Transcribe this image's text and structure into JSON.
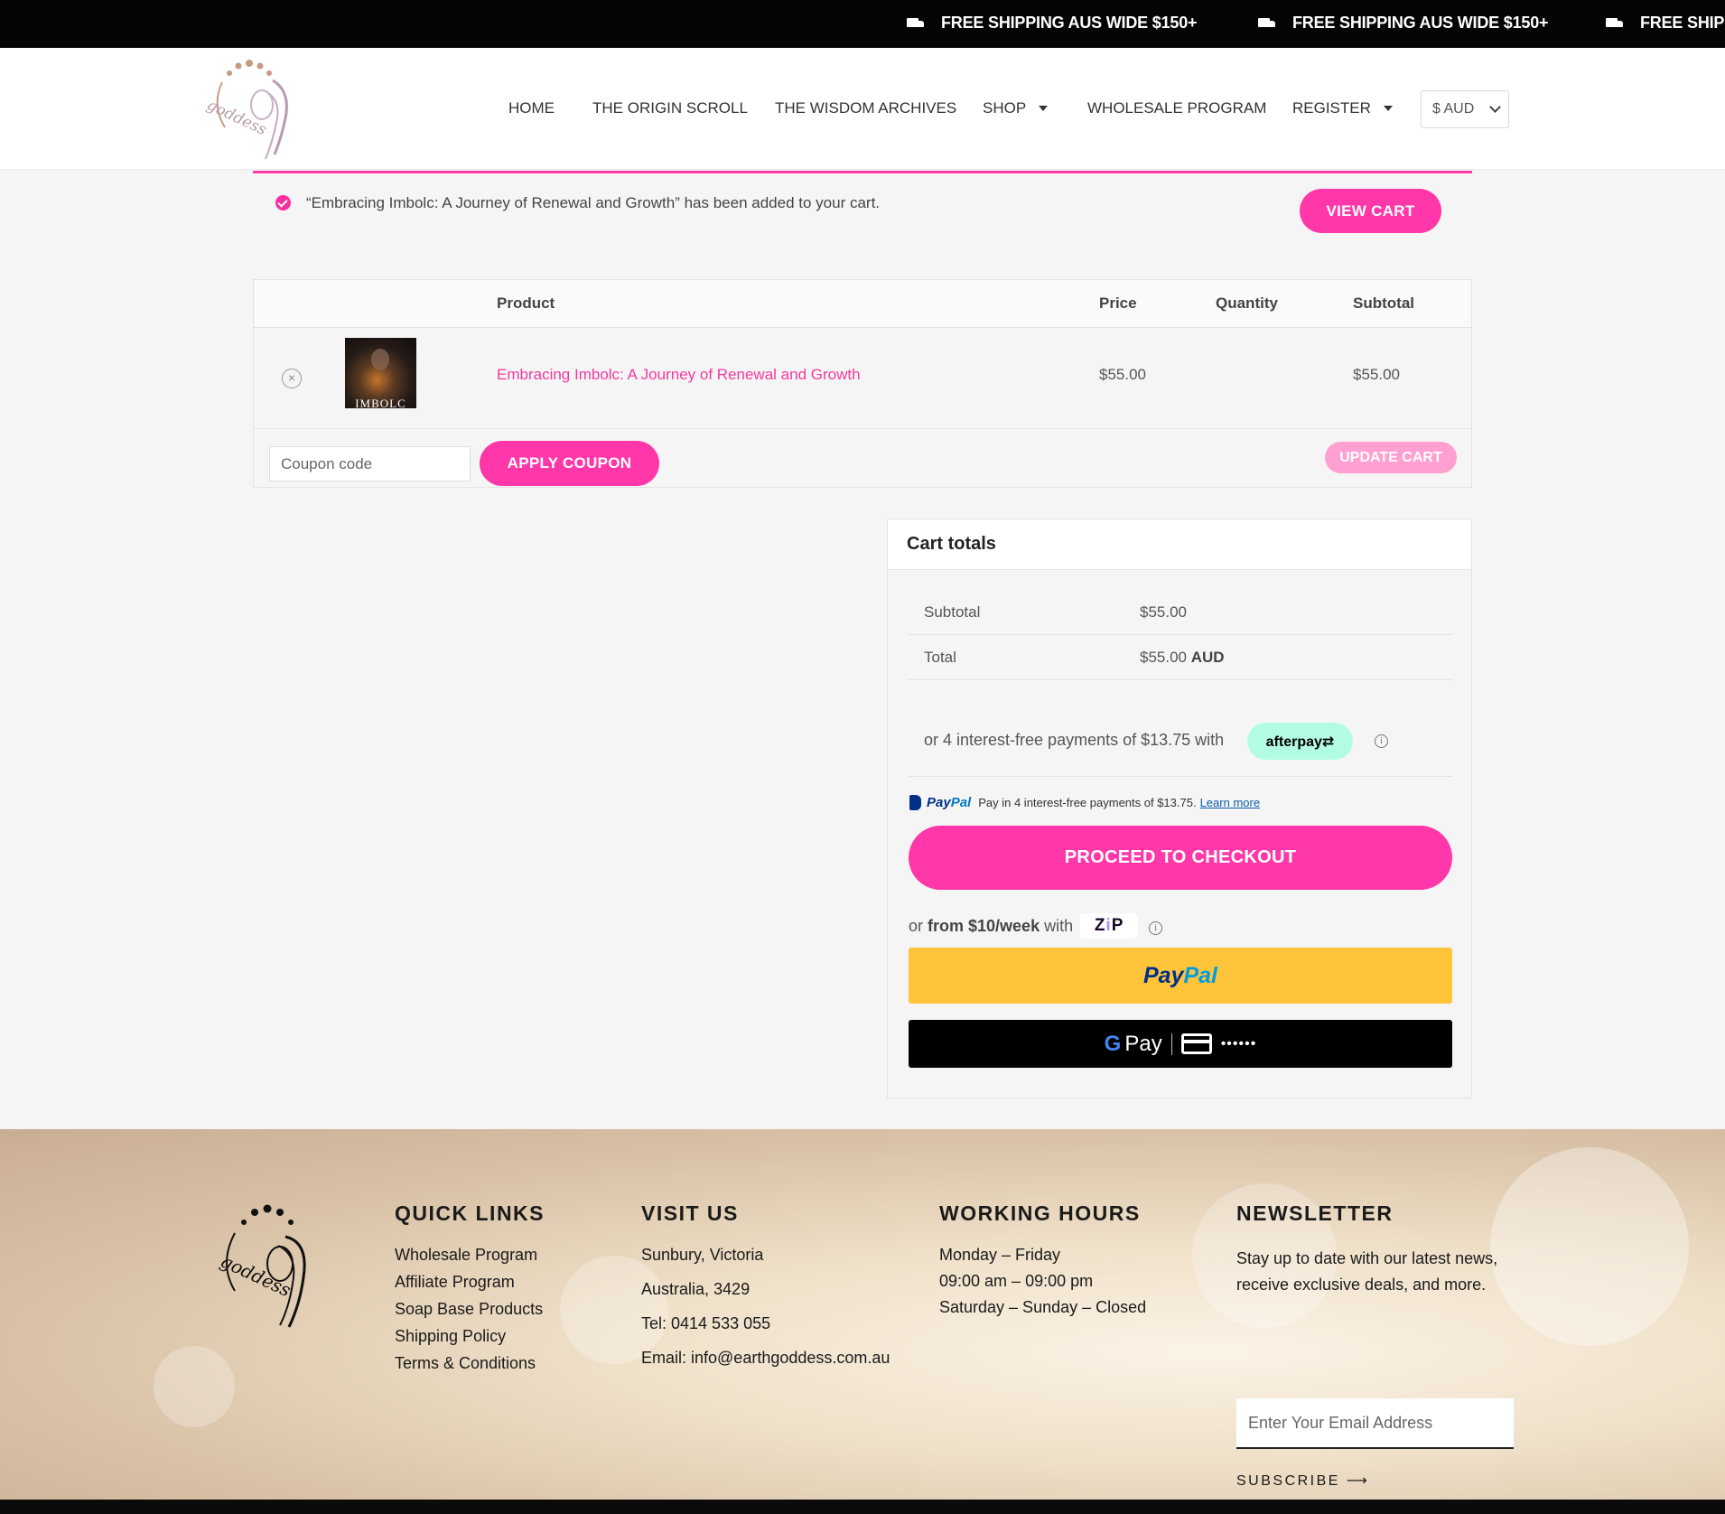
{
  "topbar": {
    "messages": [
      "FREE SHIPPING AUS WIDE $150+",
      "FREE SHIPPING AUS WIDE $150+",
      "FREE SHIPPI"
    ]
  },
  "header": {
    "logo_icon": "earth-goddess-logo",
    "nav": [
      {
        "label": "HOME"
      },
      {
        "label": "THE ORIGIN SCROLL"
      },
      {
        "label": "THE WISDOM ARCHIVES"
      },
      {
        "label": "SHOP",
        "dropdown": true
      },
      {
        "label": "WHOLESALE PROGRAM"
      },
      {
        "label": "REGISTER",
        "dropdown": true
      }
    ],
    "currency": "$ AUD"
  },
  "notice": {
    "text": "“Embracing Imbolc: A Journey of Renewal and Growth” has been added to your cart.",
    "button": "VIEW CART"
  },
  "cart": {
    "headers": {
      "product": "Product",
      "price": "Price",
      "quantity": "Quantity",
      "subtotal": "Subtotal"
    },
    "items": [
      {
        "remove": "×",
        "thumb_label": "IMBOLC",
        "name": "Embracing Imbolc: A Journey of Renewal and Growth",
        "price": "$55.00",
        "quantity": "",
        "subtotal": "$55.00"
      }
    ],
    "coupon_placeholder": "Coupon code",
    "apply_coupon": "APPLY COUPON",
    "update_cart": "UPDATE CART"
  },
  "totals": {
    "title": "Cart totals",
    "subtotal_label": "Subtotal",
    "subtotal_value": "$55.00",
    "total_label": "Total",
    "total_value": "$55.00",
    "total_currency": "AUD",
    "afterpay_text": "or 4 interest-free payments of $13.75 with",
    "afterpay_logo": "afterpay⇄",
    "paypal_msg_logo_a": "Pay",
    "paypal_msg_logo_b": "Pal",
    "paypal_msg": "Pay in 4 interest-free payments of $13.75.",
    "paypal_learn_more": "Learn more",
    "checkout": "PROCEED TO CHECKOUT",
    "zip_prefix": "or",
    "zip_bold": "from $10/week",
    "zip_suffix": "with",
    "zip_logo_a": "Z",
    "zip_logo_b": "i",
    "zip_logo_c": "P",
    "paypal_button_a": "Pay",
    "paypal_button_b": "Pal",
    "gpay_label": "Pay",
    "gpay_dots": "••••••"
  },
  "footer": {
    "quick_links": {
      "title": "QUICK LINKS",
      "items": [
        "Wholesale Program",
        "Affiliate Program",
        "Soap Base Products",
        "Shipping Policy",
        "Terms & Conditions"
      ]
    },
    "visit": {
      "title": "VISIT US",
      "items": [
        "Sunbury, Victoria",
        "Australia, 3429",
        "Tel: 0414 533 055",
        "Email: info@earthgoddess.com.au"
      ]
    },
    "hours": {
      "title": "WORKING HOURS",
      "items": [
        "Monday – Friday",
        "09:00 am – 09:00 pm",
        "Saturday – Sunday – Closed"
      ]
    },
    "newsletter": {
      "title": "NEWSLETTER",
      "text": "Stay up to date with our latest news, receive exclusive deals, and more.",
      "placeholder": "Enter Your Email Address",
      "subscribe": "SUBSCRIBE ⟶"
    }
  }
}
